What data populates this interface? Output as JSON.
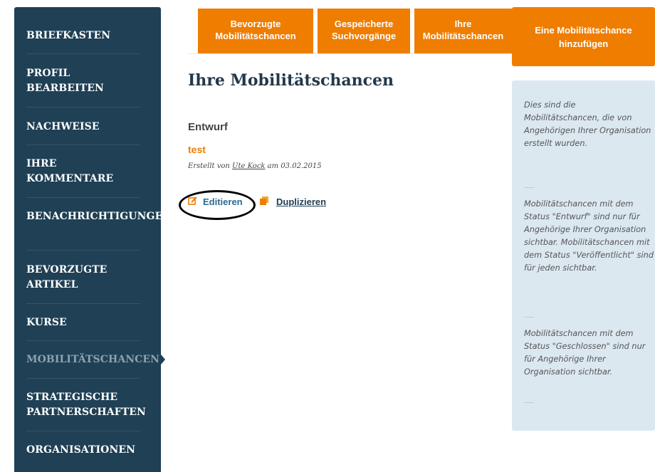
{
  "sidebar": {
    "items": [
      {
        "label": "BRIEFKASTEN"
      },
      {
        "label": "PROFIL\nBEARBEITEN"
      },
      {
        "label": "NACHWEISE"
      },
      {
        "label": "IHRE\nKOMMENTARE"
      },
      {
        "label": "BENACHRICHTIGUNGEN\nVERWALTEN"
      },
      {
        "label": "BEVORZUGTE\nARTIKEL"
      },
      {
        "label": "KURSE"
      },
      {
        "label": "MOBILITÄTSCHANCEN"
      },
      {
        "label": "STRATEGISCHE\nPARTNERSCHAFTEN"
      },
      {
        "label": "ORGANISATIONEN"
      }
    ],
    "active": "MOBILITÄTSCHANCEN"
  },
  "tabs": [
    {
      "label": "Bevorzugte\nMobilitätschancen"
    },
    {
      "label": "Gespeicherte\nSuchvorgänge"
    },
    {
      "label": "Ihre\nMobilitätschancen"
    }
  ],
  "add_button": {
    "label": "Eine Mobilitätschance\nhinzufügen"
  },
  "main": {
    "title": "Ihre Mobilitätschancen",
    "status_heading": "Entwurf",
    "item": {
      "title": "test",
      "created_prefix": "Erstellt von",
      "author": "Ute Kock",
      "date_prefix": "am",
      "date": "03.02.2015"
    },
    "actions": {
      "edit_label": "Editieren",
      "duplicate_label": "Duplizieren"
    }
  },
  "info": {
    "paragraphs": [
      "Dies sind die Mobilitätschancen, die von Angehörigen Ihrer Organisation erstellt wurden.",
      "Mobilitätschancen mit dem Status \"Entwurf\" sind nur für Angehörige Ihrer Organisation sichtbar. Mobilitätschancen mit dem Status \"Veröffentlicht\" sind für jeden sichtbar.",
      "Mobilitätschancen mit dem Status \"Geschlossen\" sind nur für Angehörige Ihrer Organisation sichtbar."
    ]
  },
  "colors": {
    "sidebar_bg": "#1f4055",
    "accent_orange": "#ef7d00",
    "info_bg": "#dce8f0",
    "link_blue": "#2a6a92"
  },
  "icons": {
    "edit": "edit-icon",
    "duplicate": "duplicate-icon"
  }
}
